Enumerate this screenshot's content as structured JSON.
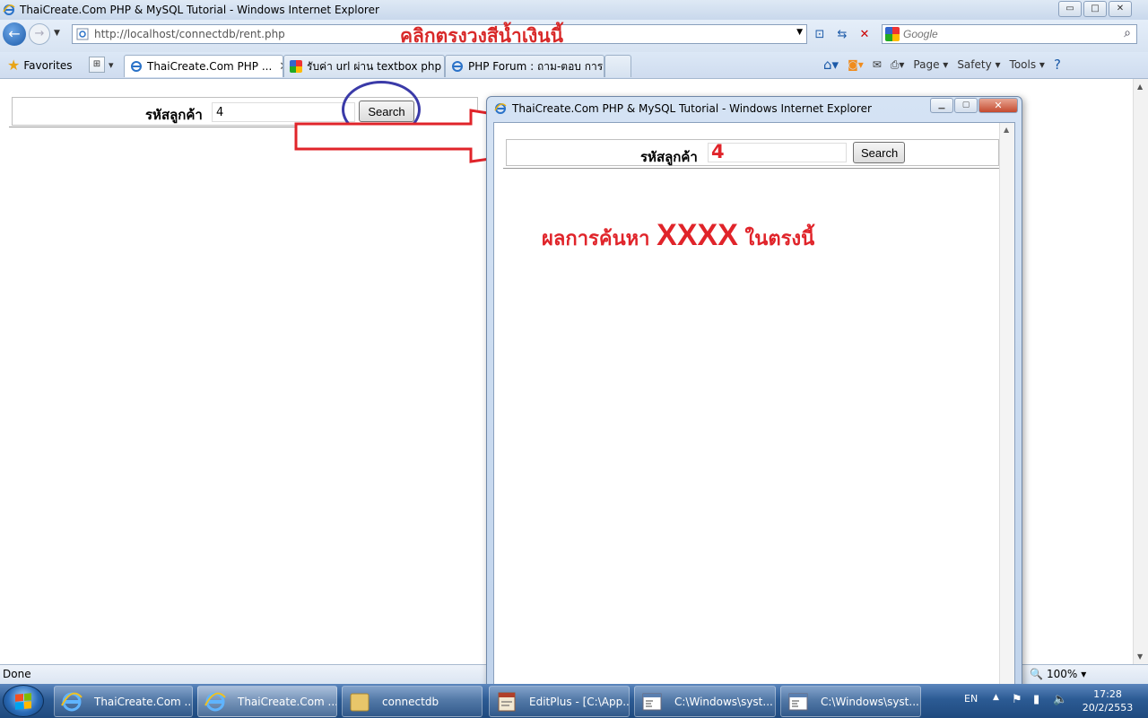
{
  "window": {
    "title": "ThaiCreate.Com PHP & MySQL Tutorial - Windows Internet Explorer",
    "min": "▭",
    "max": "□",
    "close": "✕"
  },
  "addressbar": {
    "url": "http://localhost/connectdb/rent.php",
    "search_placeholder": "Google",
    "annotation": "คลิกตรงวงสีน้ำเงินนี้"
  },
  "favorites": {
    "label": "Favorites"
  },
  "tabs": [
    {
      "label": "ThaiCreate.Com PHP ...",
      "close": "✕"
    },
    {
      "label": "รับค่า url ผ่าน textbox php - ..."
    },
    {
      "label": "PHP Forum : ถาม-ตอบ การเ..."
    }
  ],
  "commandbar": {
    "page": "Page ▾",
    "safety": "Safety ▾",
    "tools": "Tools ▾",
    "help": "?"
  },
  "main_form": {
    "label": "รหัสลูกค้า",
    "value": "4",
    "button": "Search"
  },
  "status": {
    "text": "Done",
    "zoom": "100%"
  },
  "popup": {
    "title": "ThaiCreate.Com PHP & MySQL Tutorial - Windows Internet Explorer",
    "label": "รหัสลูกค้า",
    "value": "4",
    "button": "Search",
    "result_prefix": "ผลการค้นหา",
    "result_value": "XXXX",
    "result_suffix": "ในตรงนี้"
  },
  "taskbar": {
    "items": [
      {
        "label": "ThaiCreate.Com ..."
      },
      {
        "label": "ThaiCreate.Com ..."
      },
      {
        "label": "connectdb"
      },
      {
        "label": "EditPlus - [C:\\App..."
      },
      {
        "label": "C:\\Windows\\syst..."
      },
      {
        "label": "C:\\Windows\\syst..."
      }
    ],
    "lang": "EN",
    "time": "17:28",
    "date": "20/2/2553"
  }
}
